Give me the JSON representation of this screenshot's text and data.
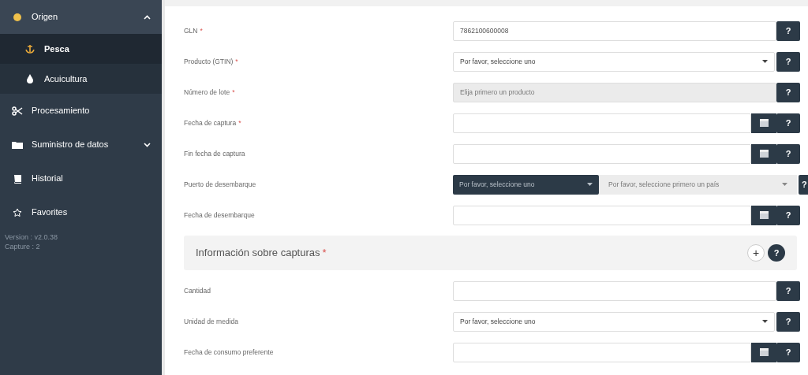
{
  "sidebar": {
    "items": [
      {
        "label": "Origen",
        "expanded": true,
        "selected": false,
        "children": [
          {
            "label": "Pesca",
            "selected": true
          },
          {
            "label": "Acuicultura",
            "selected": false
          }
        ]
      },
      {
        "label": "Procesamiento",
        "selected": false
      },
      {
        "label": "Suministro de datos",
        "expanded": false,
        "selected": false
      },
      {
        "label": "Historial",
        "selected": false
      },
      {
        "label": "Favorites",
        "selected": false
      }
    ],
    "version_lines": [
      "Version : v2.0.38",
      "Capture : 2"
    ]
  },
  "form": {
    "rows": [
      {
        "kind": "text",
        "label": "GLN",
        "required_mark": "*",
        "value": "7862100600008",
        "help": "?"
      },
      {
        "kind": "select",
        "label": "Producto (GTIN)",
        "required_mark": "*",
        "value": "Por favor, seleccione uno",
        "help": "?"
      },
      {
        "kind": "disabled",
        "label": "Número de lote",
        "required_mark": "*",
        "placeholder": "Elija primero un producto",
        "help": "?"
      },
      {
        "kind": "date",
        "label": "Fecha de captura",
        "required_mark": "*",
        "help": "?"
      },
      {
        "kind": "date",
        "label": "Fin fecha de captura",
        "help": "?"
      },
      {
        "kind": "dual",
        "label": "Puerto de desembarque",
        "value": "Por favor, seleccione uno",
        "second_value": "Por favor, seleccione primero un país",
        "help": "?"
      },
      {
        "kind": "date",
        "label": "Fecha de desembarque",
        "help": "?"
      },
      {
        "kind": "section",
        "label": "Información sobre capturas",
        "required_mark": "*",
        "add": "+",
        "help": "?"
      },
      {
        "kind": "text",
        "label": "Cantidad",
        "help": "?"
      },
      {
        "kind": "select",
        "label": "Unidad de medida",
        "value": "Por favor, seleccione uno",
        "help": "?"
      },
      {
        "kind": "date",
        "label": "Fecha de consumo preferente",
        "help": "?"
      }
    ]
  }
}
